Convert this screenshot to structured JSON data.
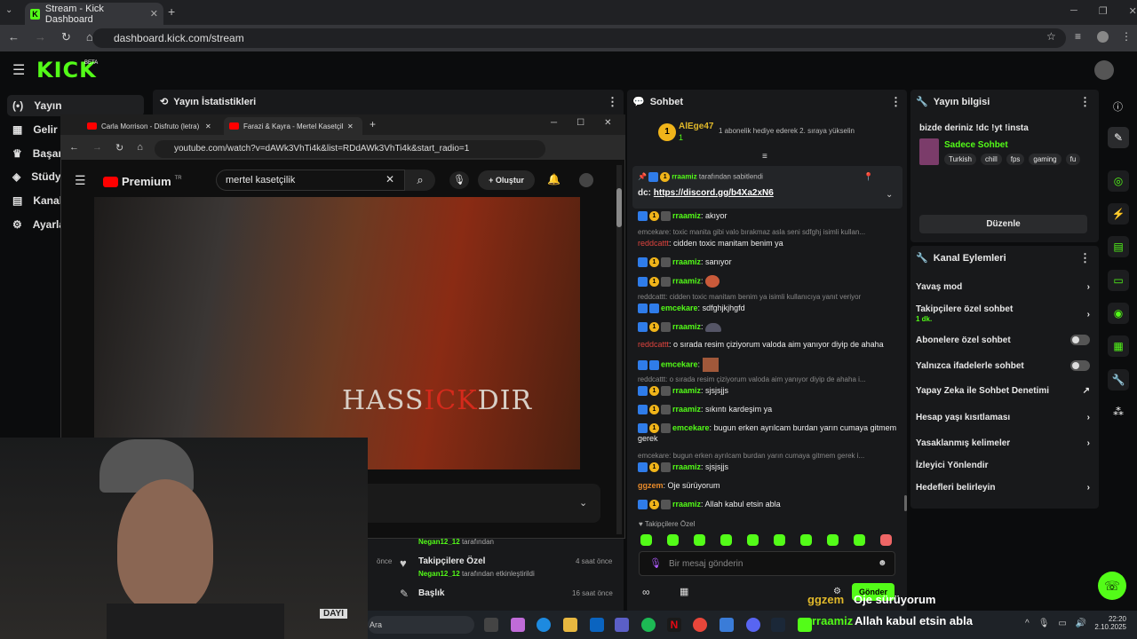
{
  "browser": {
    "tab_title": "Stream - Kick Dashboard",
    "url": "dashboard.kick.com/stream"
  },
  "kick": {
    "logo": "KICK",
    "beta": "BETA"
  },
  "sidebar": {
    "items": [
      {
        "label": "Yayın"
      },
      {
        "label": "Gelir"
      },
      {
        "label": "Başarı"
      },
      {
        "label": "Stüdyo"
      },
      {
        "label": "Kanal"
      },
      {
        "label": "Ayarla"
      }
    ]
  },
  "stats": {
    "title": "Yayın İstatistikleri"
  },
  "youtube": {
    "tab1": "Carla Morrison - Disfruto (letra)",
    "tab2": "Farazi & Kayra - Mertel Kasetçilik",
    "url": "youtube.com/watch?v=dAWk3VhTi4k&list=RDdAWk3VhTi4k&start_radio=1",
    "brand": "Premium",
    "brand_sup": "TR",
    "search": "mertel kasetçilik",
    "create": "Oluştur",
    "video_text": "HASSICKDIR",
    "video_text_red": "ICK"
  },
  "activity": [
    {
      "user": "Negan12_12",
      "suffix": "tarafından",
      "title": "",
      "time": ""
    },
    {
      "title": "Takipçilere Özel",
      "user": "Negan12_12",
      "suffix": "tarafından etkinleştirildi",
      "time": "4 saat önce"
    },
    {
      "title": "Başlık",
      "time": "16 saat önce"
    }
  ],
  "partial_time": "önce",
  "chat": {
    "title": "Sohbet",
    "top_user": "AlEge47",
    "top_count": "1",
    "gift_text": "1 abonelik hediye ederek 2. sıraya yükselin",
    "pinned_by": "rraamiz",
    "pinned_suffix": "tarafından sabitlendi",
    "pinned_prefix": "dc:",
    "pinned_link": "https://discord.gg/b4Xa2xN6",
    "messages": [
      {
        "user": "rraamiz",
        "text": "akıyor",
        "type": "g"
      },
      {
        "reply": "emcekare: toxic manita gibi valo bırakmaz asla seni sdfghj isimli kullan..."
      },
      {
        "user": "reddcattt",
        "text": "cidden toxic manitam benim ya",
        "type": "r"
      },
      {
        "user": "rraamiz",
        "text": "sanıyor",
        "type": "g"
      },
      {
        "user": "rraamiz",
        "text": "",
        "type": "g"
      },
      {
        "reply": "reddcattt: cidden toxic manitam benim ya isimli kullanıcıya yanıt veriyor"
      },
      {
        "user": "emcekare",
        "text": "sdfghjkjhgfd",
        "type": "g"
      },
      {
        "user": "rraamiz",
        "text": "",
        "type": "g"
      },
      {
        "user": "reddcattt",
        "text": "o sırada resim çiziyorum valoda aim yanıyor diyip de ahaha",
        "type": "r"
      },
      {
        "user": "emcekare",
        "text": "",
        "type": "g"
      },
      {
        "reply": "reddcattt: o sırada resim çiziyorum valoda aim yanıyor diyip de ahaha i..."
      },
      {
        "user": "rraamiz",
        "text": "sjsjsjjs",
        "type": "g"
      },
      {
        "user": "rraamiz",
        "text": "sıkıntı kardeşim ya",
        "type": "g"
      },
      {
        "user": "emcekare",
        "text": "bugun erken ayrılcam burdan yarın cumaya gitmem gerek",
        "type": "g"
      },
      {
        "reply": "emcekare: bugun erken ayrılcam burdan yarın cumaya gitmem gerek i..."
      },
      {
        "user": "rraamiz",
        "text": "sjsjsjjs",
        "type": "g"
      },
      {
        "user": "ggzem",
        "text": "Oje sürüyorum",
        "type": "o"
      },
      {
        "user": "rraamiz",
        "text": "Allah kabul etsin abla",
        "type": "g"
      }
    ],
    "followers_only": "Takipçilere Özel",
    "input_placeholder": "Bir mesaj gönderin",
    "send": "Gönder"
  },
  "overlay": {
    "user1": "ggzem",
    "msg1": "Oje sürüyorum",
    "user2": "rraamiz",
    "msg2": "Allah kabul etsin abla"
  },
  "stream_info": {
    "title": "Yayın bilgisi",
    "stream_title": "bizde deriniz !dc !yt !insta",
    "category": "Sadece Sohbet",
    "tags": [
      "Turkish",
      "chill",
      "fps",
      "gaming",
      "fu"
    ],
    "edit": "Düzenle"
  },
  "actions": {
    "title": "Kanal Eylemleri",
    "items": [
      {
        "label": "Yavaş mod",
        "kind": "arrow"
      },
      {
        "label": "Takipçilere özel sohbet",
        "sub": "1 dk.",
        "kind": "arrow"
      },
      {
        "label": "Abonelere özel sohbet",
        "kind": "toggle"
      },
      {
        "label": "Yalnızca ifadelerle sohbet",
        "kind": "toggle"
      },
      {
        "label": "Yapay Zeka ile Sohbet Denetimi",
        "kind": "ext"
      },
      {
        "label": "Hesap yaşı kısıtlaması",
        "kind": "arrow"
      },
      {
        "label": "Yasaklanmış kelimeler",
        "kind": "arrow"
      },
      {
        "label": "İzleyici Yönlendir",
        "kind": "none"
      },
      {
        "label": "Hedefleri belirleyin",
        "kind": "arrow"
      }
    ]
  },
  "taskbar": {
    "search": "Ara",
    "time": "22:20",
    "date": "2.10.2025"
  },
  "webcam": {
    "chair_text": "DAYI"
  }
}
